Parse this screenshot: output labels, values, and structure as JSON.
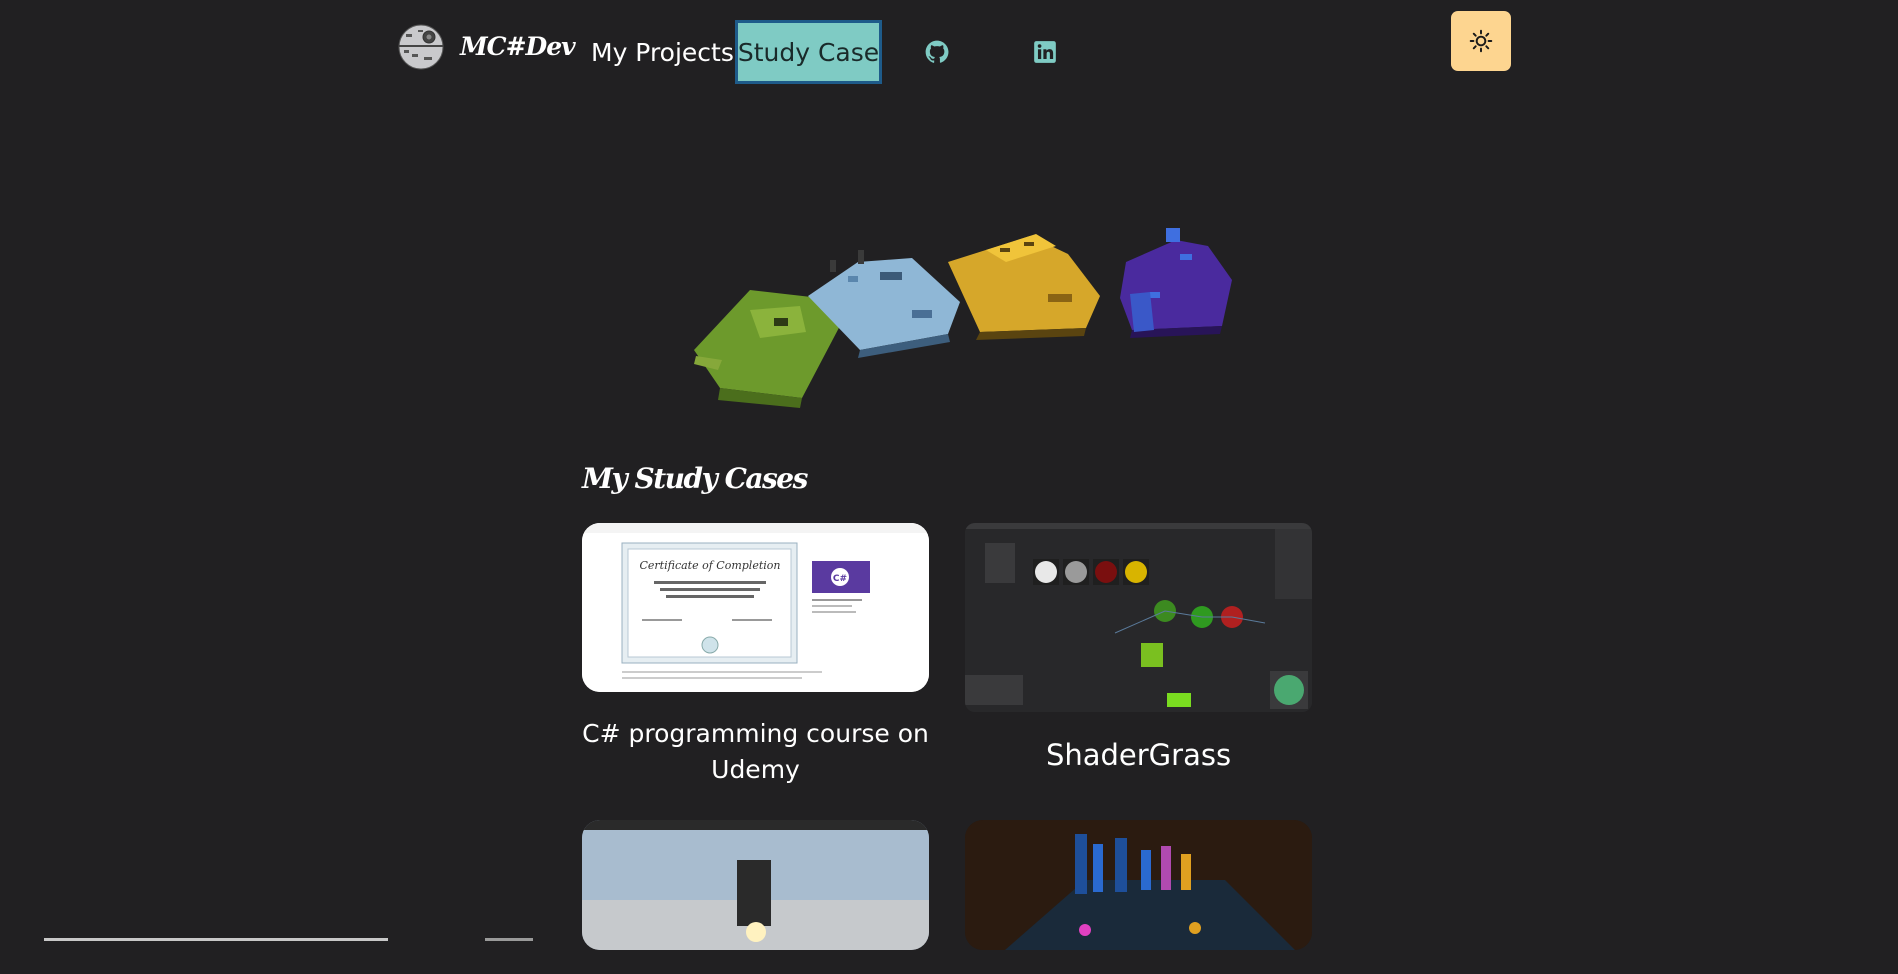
{
  "nav": {
    "brand": "MC#Dev",
    "links": [
      {
        "label": "My Projects"
      },
      {
        "label": "Study Case"
      }
    ],
    "icons": [
      "github-icon",
      "linkedin-icon",
      "sun-icon"
    ]
  },
  "colors": {
    "background": "#212022",
    "active_tab": "#7fcbc4",
    "active_tab_border": "#1e5b8a",
    "theme_button": "#fdd590",
    "social_icon": "#7fcbc4"
  },
  "section": {
    "title": "My Study Cases"
  },
  "cards": [
    {
      "title": "C# programming course on Udemy"
    },
    {
      "title": "ShaderGrass"
    },
    {
      "title": ""
    },
    {
      "title": ""
    }
  ],
  "certificate": {
    "heading": "Certificate of Completion",
    "badge": "C#"
  }
}
